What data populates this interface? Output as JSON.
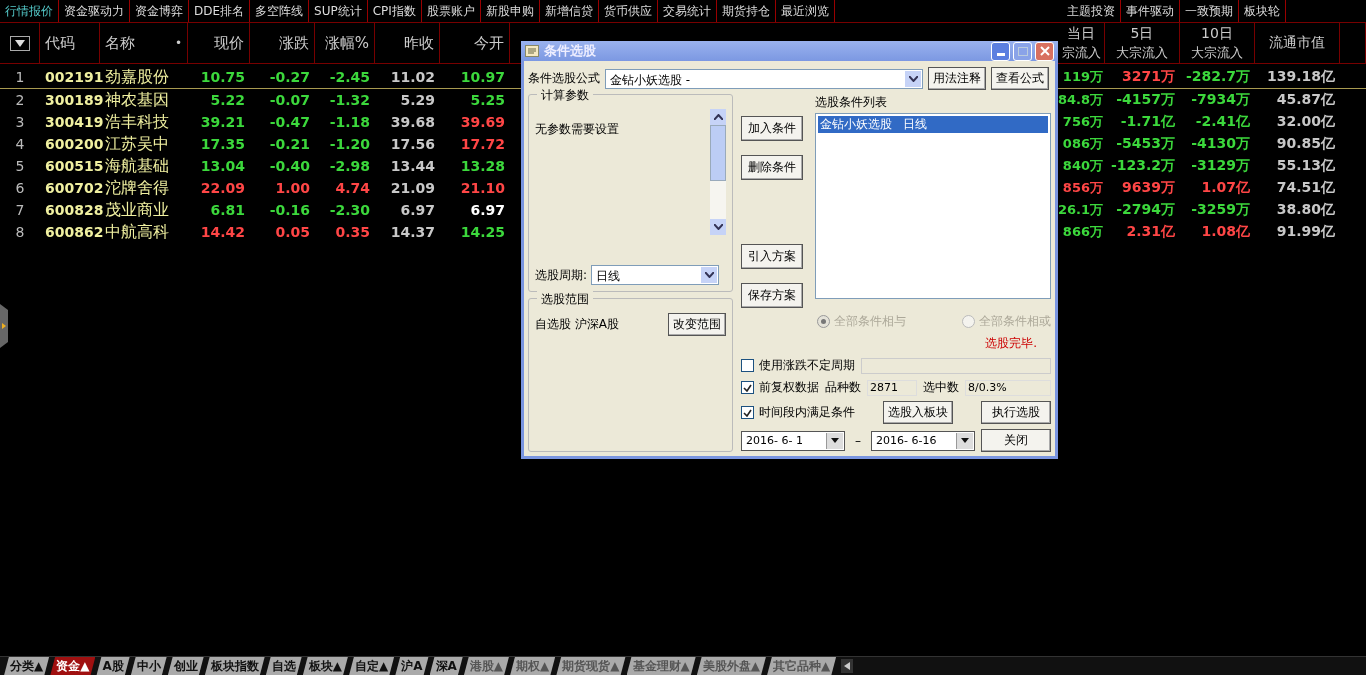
{
  "menu": [
    {
      "label": "行情报价",
      "selected": true
    },
    {
      "label": "资金驱动力",
      "selected": false
    },
    {
      "label": "资金博弈",
      "selected": false
    },
    {
      "label": "DDE排名",
      "selected": false
    },
    {
      "label": "多空阵线",
      "selected": false
    },
    {
      "label": "SUP统计",
      "selected": false
    },
    {
      "label": "CPI指数",
      "selected": false
    },
    {
      "label": "股票账户",
      "selected": false
    },
    {
      "label": "新股申购",
      "selected": false
    },
    {
      "label": "新增信贷",
      "selected": false
    },
    {
      "label": "货币供应",
      "selected": false
    },
    {
      "label": "交易统计",
      "selected": false
    },
    {
      "label": "期货持仓",
      "selected": false
    },
    {
      "label": "最近浏览",
      "selected": false
    }
  ],
  "menu_right": [
    {
      "label": "主题投资",
      "selected": false
    },
    {
      "label": "事件驱动",
      "selected": false
    },
    {
      "label": "一致预期",
      "selected": false
    },
    {
      "label": "板块轮",
      "selected": false
    }
  ],
  "table": {
    "columns": [
      {
        "label": "代码"
      },
      {
        "label": "名称"
      },
      {
        "label": "现价"
      },
      {
        "label": "涨跌"
      },
      {
        "label": "涨幅%"
      },
      {
        "label": "昨收"
      },
      {
        "label": "今开"
      },
      {
        "label": "当日",
        "sub": "宗流入"
      },
      {
        "label": "5日",
        "sub": "大宗流入"
      },
      {
        "label": "10日",
        "sub": "大宗流入"
      },
      {
        "label": "流通市值"
      }
    ],
    "sort_marker": "•",
    "rows": [
      {
        "index": "1",
        "selected": true,
        "cells": [
          {
            "text": "002191",
            "color": "#f0f0a0"
          },
          {
            "text": "劲嘉股份",
            "color": "#f0f0a0"
          },
          {
            "text": "10.75",
            "color": "#3cd83c"
          },
          {
            "text": "-0.27",
            "color": "#3cd83c"
          },
          {
            "text": "-2.45",
            "color": "#3cd83c"
          },
          {
            "text": "11.02",
            "color": "#c8c8c8"
          },
          {
            "text": "10.97",
            "color": "#3cd83c"
          },
          {
            "text": "119万",
            "color": "#3cd83c"
          },
          {
            "text": "3271万",
            "color": "#ff4646"
          },
          {
            "text": "-282.7万",
            "color": "#3cd83c"
          },
          {
            "text": "139.18亿",
            "color": "#c8c8c8"
          }
        ]
      },
      {
        "index": "2",
        "selected": false,
        "cells": [
          {
            "text": "300189",
            "color": "#f0f0a0"
          },
          {
            "text": "神农基因",
            "color": "#f0f0a0"
          },
          {
            "text": "5.22",
            "color": "#3cd83c"
          },
          {
            "text": "-0.07",
            "color": "#3cd83c"
          },
          {
            "text": "-1.32",
            "color": "#3cd83c"
          },
          {
            "text": "5.29",
            "color": "#c8c8c8"
          },
          {
            "text": "5.25",
            "color": "#3cd83c"
          },
          {
            "text": "84.8万",
            "color": "#3cd83c"
          },
          {
            "text": "-4157万",
            "color": "#3cd83c"
          },
          {
            "text": "-7934万",
            "color": "#3cd83c"
          },
          {
            "text": "45.87亿",
            "color": "#c8c8c8"
          }
        ]
      },
      {
        "index": "3",
        "selected": false,
        "cells": [
          {
            "text": "300419",
            "color": "#f0f0a0"
          },
          {
            "text": "浩丰科技",
            "color": "#f0f0a0"
          },
          {
            "text": "39.21",
            "color": "#3cd83c"
          },
          {
            "text": "-0.47",
            "color": "#3cd83c"
          },
          {
            "text": "-1.18",
            "color": "#3cd83c"
          },
          {
            "text": "39.68",
            "color": "#c8c8c8"
          },
          {
            "text": "39.69",
            "color": "#ff4646"
          },
          {
            "text": "756万",
            "color": "#3cd83c"
          },
          {
            "text": "-1.71亿",
            "color": "#3cd83c"
          },
          {
            "text": "-2.41亿",
            "color": "#3cd83c"
          },
          {
            "text": "32.00亿",
            "color": "#c8c8c8"
          }
        ]
      },
      {
        "index": "4",
        "selected": false,
        "cells": [
          {
            "text": "600200",
            "color": "#f0f0a0"
          },
          {
            "text": "江苏吴中",
            "color": "#f0f0a0"
          },
          {
            "text": "17.35",
            "color": "#3cd83c"
          },
          {
            "text": "-0.21",
            "color": "#3cd83c"
          },
          {
            "text": "-1.20",
            "color": "#3cd83c"
          },
          {
            "text": "17.56",
            "color": "#c8c8c8"
          },
          {
            "text": "17.72",
            "color": "#ff4646"
          },
          {
            "text": "086万",
            "color": "#3cd83c"
          },
          {
            "text": "-5453万",
            "color": "#3cd83c"
          },
          {
            "text": "-4130万",
            "color": "#3cd83c"
          },
          {
            "text": "90.85亿",
            "color": "#c8c8c8"
          }
        ]
      },
      {
        "index": "5",
        "selected": false,
        "cells": [
          {
            "text": "600515",
            "color": "#f0f0a0"
          },
          {
            "text": "海航基础",
            "color": "#f0f0a0"
          },
          {
            "text": "13.04",
            "color": "#3cd83c"
          },
          {
            "text": "-0.40",
            "color": "#3cd83c"
          },
          {
            "text": "-2.98",
            "color": "#3cd83c"
          },
          {
            "text": "13.44",
            "color": "#c8c8c8"
          },
          {
            "text": "13.28",
            "color": "#3cd83c"
          },
          {
            "text": "840万",
            "color": "#3cd83c"
          },
          {
            "text": "-123.2万",
            "color": "#3cd83c"
          },
          {
            "text": "-3129万",
            "color": "#3cd83c"
          },
          {
            "text": "55.13亿",
            "color": "#c8c8c8"
          }
        ]
      },
      {
        "index": "6",
        "selected": false,
        "cells": [
          {
            "text": "600702",
            "color": "#f0f0a0"
          },
          {
            "text": "沱牌舍得",
            "color": "#f0f0a0"
          },
          {
            "text": "22.09",
            "color": "#ff4646"
          },
          {
            "text": "1.00",
            "color": "#ff4646"
          },
          {
            "text": "4.74",
            "color": "#ff4646"
          },
          {
            "text": "21.09",
            "color": "#c8c8c8"
          },
          {
            "text": "21.10",
            "color": "#ff4646"
          },
          {
            "text": "856万",
            "color": "#ff4646"
          },
          {
            "text": "9639万",
            "color": "#ff4646"
          },
          {
            "text": "1.07亿",
            "color": "#ff4646"
          },
          {
            "text": "74.51亿",
            "color": "#c8c8c8"
          }
        ]
      },
      {
        "index": "7",
        "selected": false,
        "cells": [
          {
            "text": "600828",
            "color": "#f0f0a0"
          },
          {
            "text": "茂业商业",
            "color": "#f0f0a0"
          },
          {
            "text": "6.81",
            "color": "#3cd83c"
          },
          {
            "text": "-0.16",
            "color": "#3cd83c"
          },
          {
            "text": "-2.30",
            "color": "#3cd83c"
          },
          {
            "text": "6.97",
            "color": "#c8c8c8"
          },
          {
            "text": "6.97",
            "color": "#ffffff"
          },
          {
            "text": "26.1万",
            "color": "#3cd83c"
          },
          {
            "text": "-2794万",
            "color": "#3cd83c"
          },
          {
            "text": "-3259万",
            "color": "#3cd83c"
          },
          {
            "text": "38.80亿",
            "color": "#c8c8c8"
          }
        ]
      },
      {
        "index": "8",
        "selected": false,
        "cells": [
          {
            "text": "600862",
            "color": "#f0f0a0"
          },
          {
            "text": "中航高科",
            "color": "#f0f0a0"
          },
          {
            "text": "14.42",
            "color": "#ff4646"
          },
          {
            "text": "0.05",
            "color": "#ff4646"
          },
          {
            "text": "0.35",
            "color": "#ff4646"
          },
          {
            "text": "14.37",
            "color": "#c8c8c8"
          },
          {
            "text": "14.25",
            "color": "#3cd83c"
          },
          {
            "text": "866万",
            "color": "#3cd83c"
          },
          {
            "text": "2.31亿",
            "color": "#ff4646"
          },
          {
            "text": "1.08亿",
            "color": "#ff4646"
          },
          {
            "text": "91.99亿",
            "color": "#c8c8c8"
          }
        ]
      }
    ]
  },
  "dialog": {
    "title": "条件选股",
    "formula_label": "条件选股公式",
    "formula_value": "金钻小妖选股 -",
    "help_button": "用法注释",
    "view_button": "查看公式",
    "params_group": "计算参数",
    "params_text": "无参数需要设置",
    "period_label": "选股周期:",
    "period_value": "日线",
    "scope_group": "选股范围",
    "scope_text": "自选股 沪深A股",
    "scope_button": "改变范围",
    "mid_buttons": [
      "加入条件",
      "删除条件",
      "引入方案",
      "保存方案"
    ],
    "list_title": "选股条件列表",
    "list_items": [
      {
        "label": "金钻小妖选股   日线",
        "selected": true
      }
    ],
    "radios": [
      {
        "label": "全部条件相与",
        "selected": true,
        "disabled": true
      },
      {
        "label": "全部条件相或",
        "selected": false,
        "disabled": true
      }
    ],
    "status": "选股完毕.",
    "checks": [
      {
        "label": "使用涨跌不定周期",
        "checked": false
      },
      {
        "label": "前复权数据",
        "checked": true
      },
      {
        "label": "时间段内满足条件",
        "checked": true
      }
    ],
    "count_label": "品种数",
    "count_value": "2871",
    "hit_label": "选中数",
    "hit_value": "8/0.3%",
    "to_block_button": "选股入板块",
    "run_button": "执行选股",
    "close_button": "关闭",
    "date_from": "2016- 6- 1",
    "date_sep": "–",
    "date_to": "2016- 6-16"
  },
  "bottom_tabs": [
    {
      "label": "分类▲",
      "selected": false,
      "dimmed": false
    },
    {
      "label": "资金▲",
      "selected": true,
      "dimmed": false
    },
    {
      "label": "A股",
      "selected": false,
      "dimmed": false
    },
    {
      "label": "中小",
      "selected": false,
      "dimmed": false
    },
    {
      "label": "创业",
      "selected": false,
      "dimmed": false
    },
    {
      "label": "板块指数",
      "selected": false,
      "dimmed": false
    },
    {
      "label": "自选",
      "selected": false,
      "dimmed": false
    },
    {
      "label": "板块▲",
      "selected": false,
      "dimmed": false
    },
    {
      "label": "自定▲",
      "selected": false,
      "dimmed": false
    },
    {
      "label": "沪A",
      "selected": false,
      "dimmed": false
    },
    {
      "label": "深A",
      "selected": false,
      "dimmed": false
    },
    {
      "label": "港股▲",
      "selected": false,
      "dimmed": true
    },
    {
      "label": "期权▲",
      "selected": false,
      "dimmed": true
    },
    {
      "label": "期货现货▲",
      "selected": false,
      "dimmed": true
    },
    {
      "label": "基金理财▲",
      "selected": false,
      "dimmed": true
    },
    {
      "label": "美股外盘▲",
      "selected": false,
      "dimmed": true
    },
    {
      "label": "其它品种▲",
      "selected": false,
      "dimmed": true
    }
  ]
}
